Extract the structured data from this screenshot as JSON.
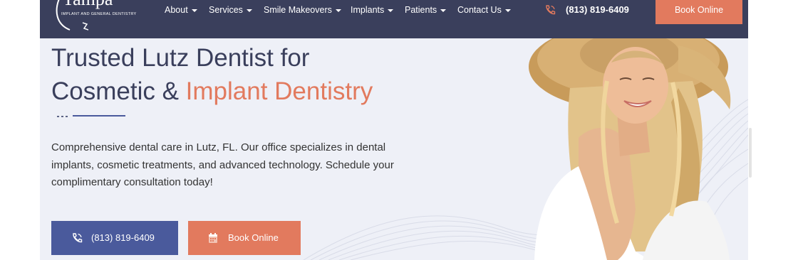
{
  "nav": {
    "logo": {
      "word": "Tampa",
      "sub": "IMPLANT AND GENERAL DENTISTRY"
    },
    "items": [
      {
        "label": "About"
      },
      {
        "label": "Services"
      },
      {
        "label": "Smile Makeovers"
      },
      {
        "label": "Implants"
      },
      {
        "label": "Patients"
      },
      {
        "label": "Contact Us"
      }
    ],
    "phone": "(813) 819-6409",
    "book_label": "Book Online"
  },
  "hero": {
    "title_line1": "Trusted Lutz Dentist for",
    "title_line2_plain": "Cosmetic & ",
    "title_line2_accent": "Implant Dentistry",
    "description": "Comprehensive dental care in Lutz, FL. Our office specializes in dental implants, cosmetic treatments, and advanced technology. Schedule your complimentary consultation today!",
    "phone_button": "(813) 819-6409",
    "book_button": "Book Online"
  },
  "colors": {
    "nav_bg": "#3a3f5c",
    "accent": "#e27a5e",
    "primary_button": "#4a5a9c",
    "page_bg": "#eef0f7",
    "heading": "#3a3f5c"
  },
  "icons": {
    "nav_phone": "phone-icon",
    "nav_caret": "chevron-down-icon",
    "phone_button": "phone-icon",
    "book_button": "calendar-icon"
  }
}
